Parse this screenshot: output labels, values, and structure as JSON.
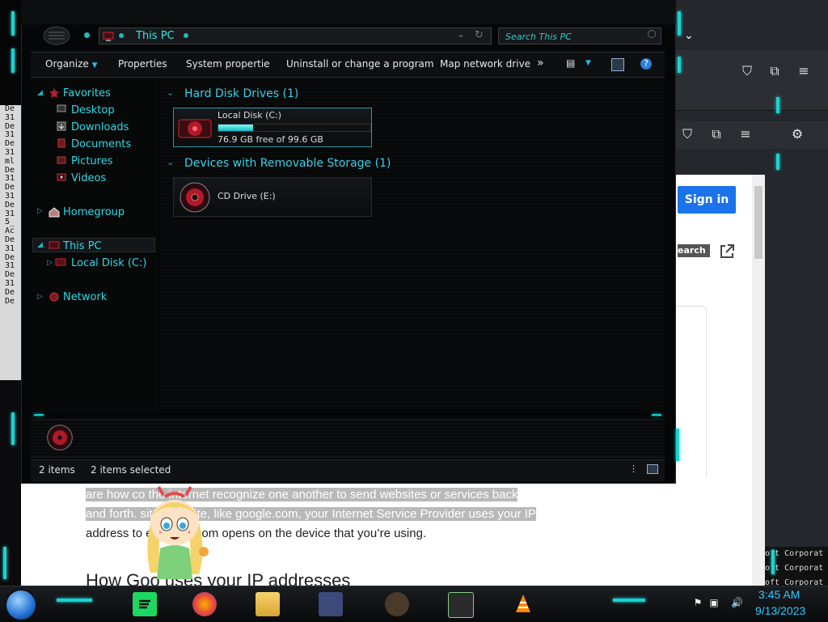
{
  "explorer": {
    "address": "This PC",
    "search_placeholder": "Search This PC",
    "toolbar": {
      "organize": "Organize",
      "properties": "Properties",
      "system_properties": "System propertie",
      "uninstall": "Uninstall or change a program",
      "map_drive": "Map network drive",
      "more": "»"
    },
    "nav": {
      "favorites": "Favorites",
      "desktop": "Desktop",
      "downloads": "Downloads",
      "documents": "Documents",
      "pictures": "Pictures",
      "videos": "Videos",
      "homegroup": "Homegroup",
      "this_pc": "This PC",
      "local_disk": "Local Disk (C:)",
      "network": "Network"
    },
    "groups": {
      "hdd": "Hard Disk Drives (1)",
      "removable": "Devices with Removable Storage (1)"
    },
    "drives": {
      "c_name": "Local Disk (C:)",
      "c_free": "76.9 GB free of 99.6 GB",
      "c_used_fraction": 0.228,
      "e_name": "CD Drive (E:)"
    },
    "status": {
      "items": "2 items",
      "selected": "2 items selected"
    }
  },
  "background": {
    "sign_in": "Sign in",
    "search_tag": "earch",
    "para_line1": "are how co              the internet recognize one another to send websites or services back",
    "para_line2": "and forth.           sit a website, like google.com, your Internet Service Provider uses your IP",
    "para_line3": "address to              e google.com opens on the device that you’re using.",
    "heading": "How Goo    uses your IP addresses",
    "right_lines": [
      "oft Corporat",
      "oft Corporat",
      "oft Corporat"
    ],
    "terminal_lines": [
      "De",
      "31",
      "De",
      "31",
      "De",
      "31",
      "ml",
      "De",
      "31",
      "De",
      "31",
      "De",
      "31",
      "5_",
      "Ac",
      "De",
      "31",
      "De",
      "31",
      "De",
      "31",
      "De",
      "De"
    ]
  },
  "taskbar": {
    "time": "3:45 AM",
    "date": "9/13/2023"
  },
  "colors": {
    "accent_cyan": "#19d3d3",
    "text_cyan": "#2fd8e6",
    "clock_blue": "#2ec9ff"
  }
}
